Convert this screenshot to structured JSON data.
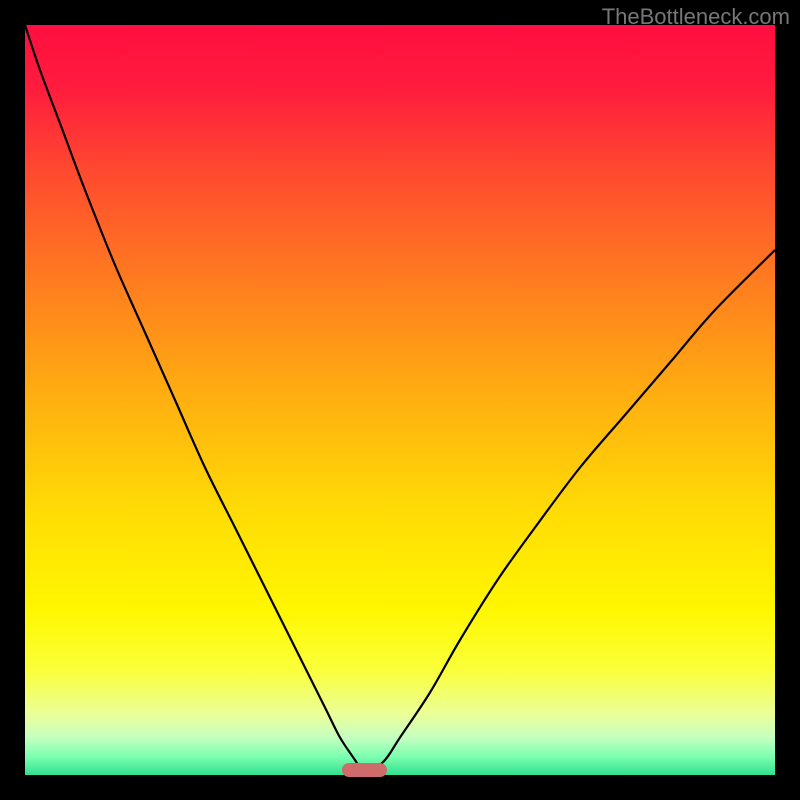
{
  "watermark": "TheBottleneck.com",
  "chart_data": {
    "type": "line",
    "title": "",
    "xlabel": "",
    "ylabel": "",
    "xlim": [
      0,
      100
    ],
    "ylim": [
      0,
      100
    ],
    "grid": false,
    "background_gradient": {
      "stops": [
        {
          "pos": 0.0,
          "color": "#ff0f3f"
        },
        {
          "pos": 0.08,
          "color": "#ff1b3e"
        },
        {
          "pos": 0.2,
          "color": "#ff4b2f"
        },
        {
          "pos": 0.35,
          "color": "#ff7f1f"
        },
        {
          "pos": 0.5,
          "color": "#ffb010"
        },
        {
          "pos": 0.65,
          "color": "#ffdc05"
        },
        {
          "pos": 0.78,
          "color": "#fff700"
        },
        {
          "pos": 0.86,
          "color": "#faff3a"
        },
        {
          "pos": 0.92,
          "color": "#eaff9a"
        },
        {
          "pos": 0.95,
          "color": "#c5ffc0"
        },
        {
          "pos": 0.975,
          "color": "#7dffb0"
        },
        {
          "pos": 1.0,
          "color": "#31e190"
        }
      ]
    },
    "series": [
      {
        "name": "bottleneck-curve",
        "x": [
          0,
          2,
          5,
          8,
          12,
          16,
          20,
          24,
          28,
          32,
          36,
          40,
          42,
          44,
          45,
          46,
          48,
          50,
          54,
          58,
          63,
          68,
          74,
          80,
          86,
          92,
          100
        ],
        "y": [
          100,
          94,
          86,
          78,
          68,
          59,
          50,
          41,
          33,
          25,
          17,
          9,
          5,
          2,
          0.5,
          0.5,
          2,
          5,
          11,
          18,
          26,
          33,
          41,
          48,
          55,
          62,
          70
        ]
      }
    ],
    "marker": {
      "x_center": 45.3,
      "y": 0,
      "width_pct": 6.0,
      "color": "#cf6b6b"
    }
  }
}
